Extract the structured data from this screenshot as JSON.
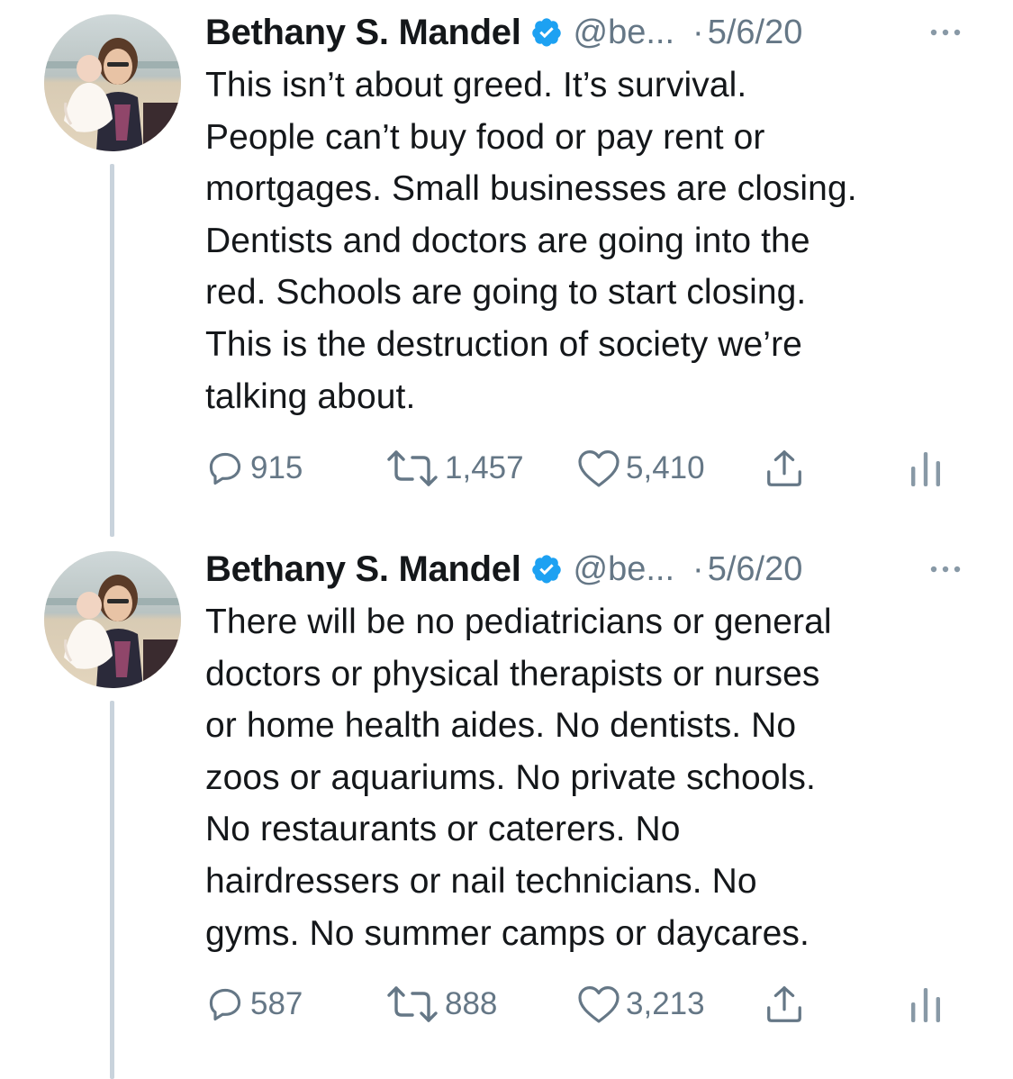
{
  "tweets": [
    {
      "author": {
        "name": "Bethany S. Mandel",
        "handle": "@be...",
        "verified": true
      },
      "separator": "·",
      "date": "5/6/20",
      "lines": [
        "This isn’t about greed. It’s survival.",
        "People can’t buy food or pay rent or",
        "mortgages. Small businesses are closing.",
        "Dentists and doctors are going into the",
        "red. Schools are going to start closing.",
        "This is the destruction of society we’re",
        "talking about."
      ],
      "stats": {
        "replies": "915",
        "retweets": "1,457",
        "likes": "5,410"
      }
    },
    {
      "author": {
        "name": "Bethany S. Mandel",
        "handle": "@be...",
        "verified": true
      },
      "separator": "·",
      "date": "5/6/20",
      "lines": [
        "There will be no pediatricians or general",
        "doctors or physical therapists or nurses",
        "or home health aides. No dentists. No",
        "zoos or aquariums. No private schools.",
        "No restaurants or caterers. No",
        "hairdressers or nail technicians. No",
        "gyms. No summer camps or daycares."
      ],
      "stats": {
        "replies": "587",
        "retweets": "888",
        "likes": "3,213"
      }
    }
  ],
  "icons": {
    "verified": "verified-badge-icon",
    "more": "more-options-icon",
    "reply": "reply-icon",
    "retweet": "retweet-icon",
    "like": "heart-icon",
    "share": "share-icon",
    "analytics": "analytics-icon"
  },
  "colors": {
    "text": "#14171a",
    "secondary": "#657786",
    "verified": "#1da1f2",
    "thread_line": "#c9d3dc",
    "background": "#ffffff"
  }
}
